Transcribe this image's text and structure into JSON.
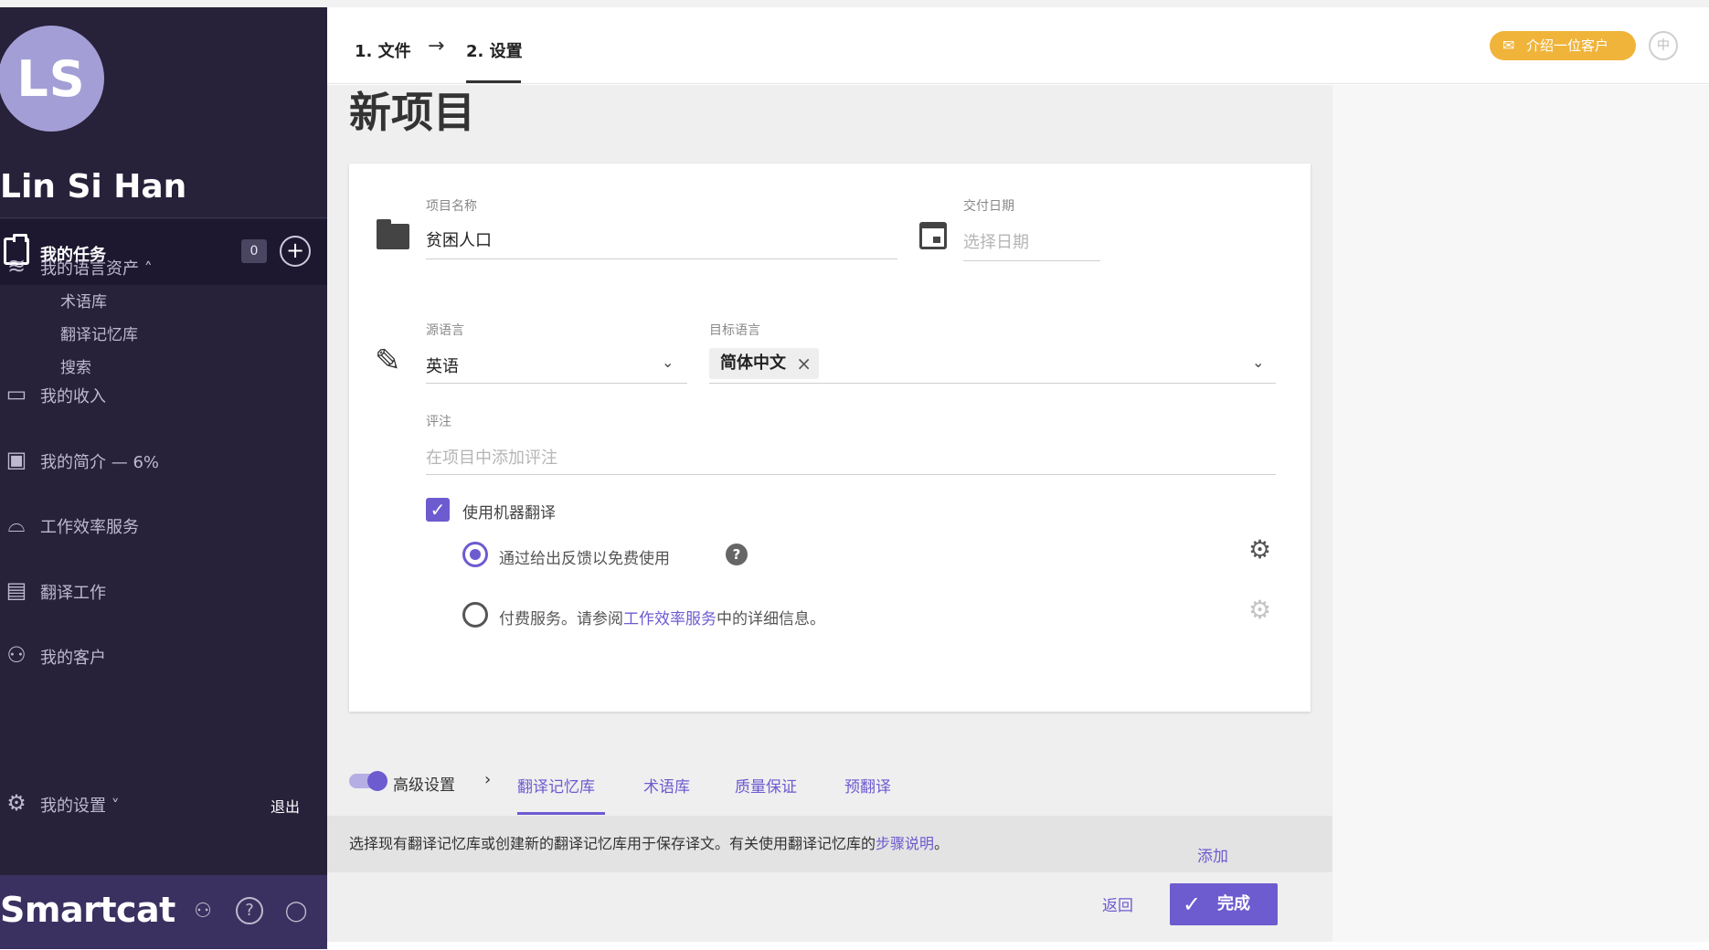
{
  "user": {
    "initials": "LS",
    "name": "Lin Si Han"
  },
  "sidebar": {
    "tasks_label": "我的任务",
    "tasks_count": "0",
    "assets_label": "我的语言资产",
    "assets_sub": [
      "术语库",
      "翻译记忆库",
      "搜索"
    ],
    "income_label": "我的收入",
    "profile_label": "我的简介 — 6%",
    "efficiency_label": "工作效率服务",
    "jobs_label": "翻译工作",
    "clients_label": "我的客户",
    "settings_label": "我的设置",
    "logout_label": "退出",
    "brand": "Smartcat"
  },
  "header": {
    "step1": "1. 文件",
    "step2": "2. 设置",
    "refer_label": "介绍一位客户"
  },
  "page": {
    "title": "新项目"
  },
  "form": {
    "project_name_label": "项目名称",
    "project_name_value": "贫困人口",
    "deadline_label": "交付日期",
    "deadline_placeholder": "选择日期",
    "source_lang_label": "源语言",
    "source_lang_value": "英语",
    "target_lang_label": "目标语言",
    "target_lang_chip": "简体中文",
    "comment_label": "评注",
    "comment_placeholder": "在项目中添加评注",
    "mt_label": "使用机器翻译",
    "mt_option1": "通过给出反馈以免费使用",
    "mt_option2_pre": "付费服务。请参阅",
    "mt_option2_link": "工作效率服务",
    "mt_option2_post": "中的详细信息。"
  },
  "tabs": {
    "advanced_label": "高级设置",
    "items": [
      "翻译记忆库",
      "术语库",
      "质量保证",
      "预翻译"
    ]
  },
  "info": {
    "text": "选择现有翻译记忆库或创建新的翻译记忆库用于保存译文。有关使用翻译记忆库的",
    "link": "步骤说明",
    "text_end": "。",
    "add_label": "添加"
  },
  "actions": {
    "back_label": "返回",
    "done_label": "完成"
  }
}
